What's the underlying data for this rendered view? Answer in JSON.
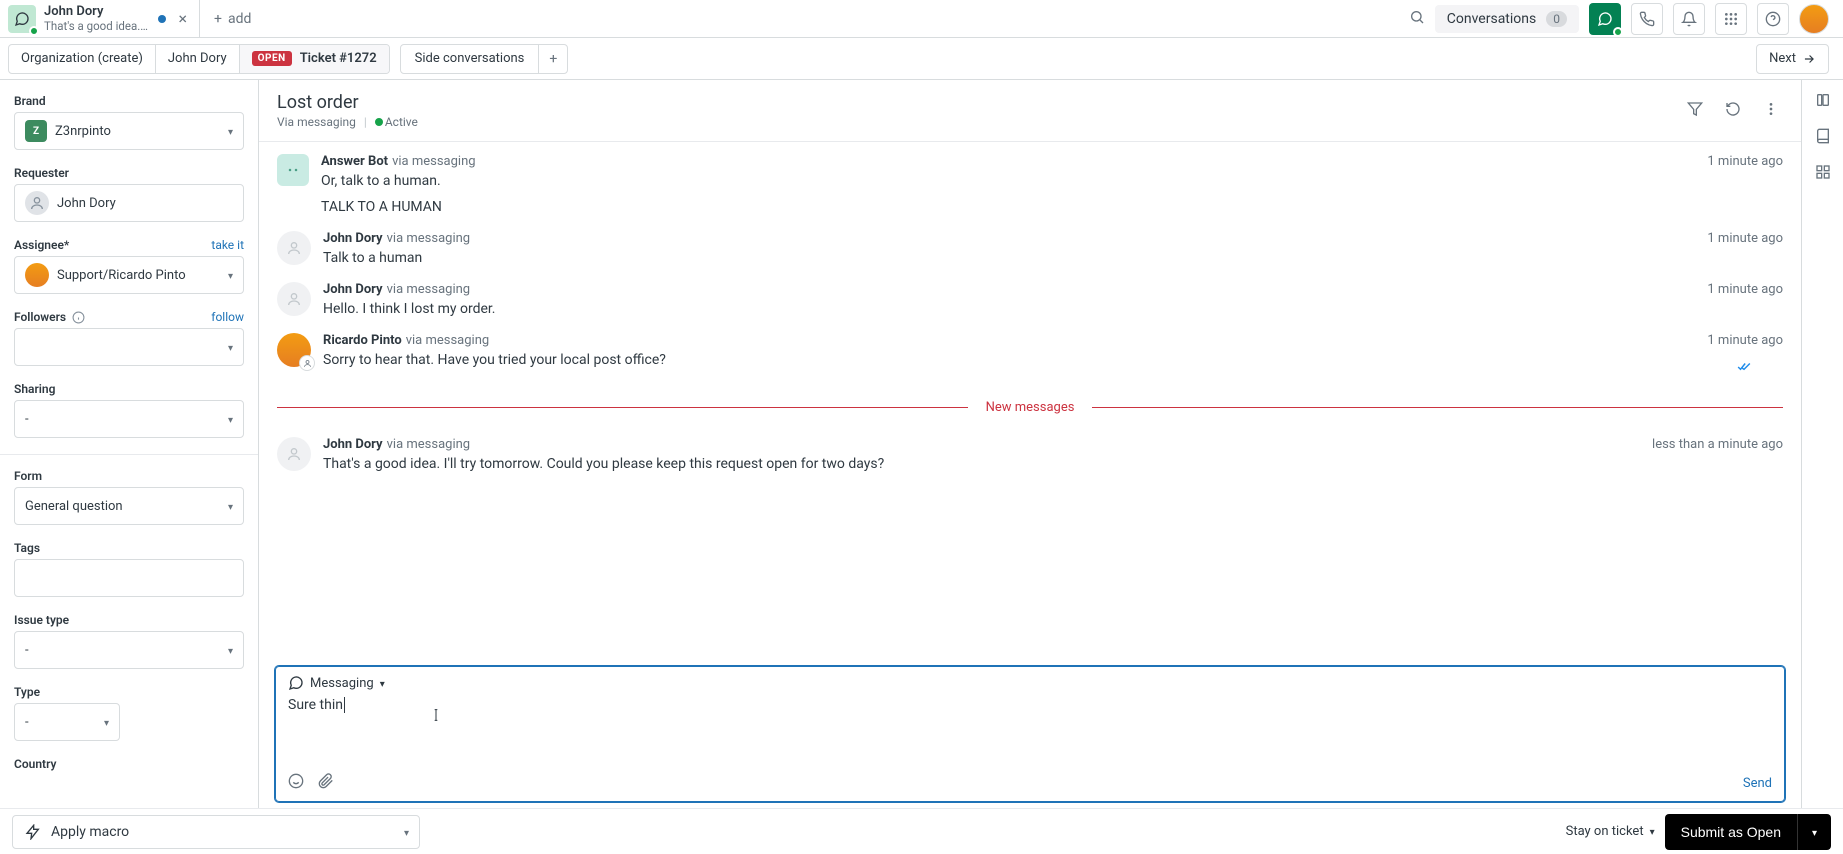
{
  "topTab": {
    "icon": "chat-icon",
    "title": "John Dory",
    "subtitle": "That's a good idea. I...",
    "close": "×"
  },
  "addTab": {
    "plus": "+",
    "label": "add"
  },
  "toolbar": {
    "conversations_label": "Conversations",
    "conversations_count": "0"
  },
  "breadcrumbs": {
    "org": "Organization (create)",
    "requester": "John Dory",
    "ticket_status": "OPEN",
    "ticket_label": "Ticket #1272"
  },
  "sideConversations": {
    "label": "Side conversations",
    "plus": "+"
  },
  "next_label": "Next",
  "sidebar": {
    "brand_label": "Brand",
    "brand_value": "Z3nrpinto",
    "requester_label": "Requester",
    "requester_value": "John Dory",
    "assignee_label": "Assignee*",
    "assignee_takeit": "take it",
    "assignee_value": "Support/Ricardo Pinto",
    "followers_label": "Followers",
    "followers_follow": "follow",
    "sharing_label": "Sharing",
    "sharing_value": "-",
    "form_label": "Form",
    "form_value": "General question",
    "tags_label": "Tags",
    "issuetype_label": "Issue type",
    "issuetype_value": "-",
    "type_label": "Type",
    "type_value": "-",
    "country_label": "Country"
  },
  "conversation": {
    "title": "Lost order",
    "via": "Via messaging",
    "activity": "Active"
  },
  "messages": [
    {
      "avatar": "bot",
      "name": "Answer Bot",
      "via": "via messaging",
      "time": "1 minute ago",
      "lines": [
        "Or, talk to a human.",
        "TALK TO A HUMAN"
      ]
    },
    {
      "avatar": "user",
      "name": "John Dory",
      "via": "via messaging",
      "time": "1 minute ago",
      "lines": [
        "Talk to a human"
      ]
    },
    {
      "avatar": "user",
      "name": "John Dory",
      "via": "via messaging",
      "time": "1 minute ago",
      "lines": [
        "Hello. I think I lost my order."
      ]
    },
    {
      "avatar": "agent",
      "name": "Ricardo Pinto",
      "via": "via messaging",
      "time": "1 minute ago",
      "lines": [
        "Sorry to hear that. Have you tried your local post office?"
      ],
      "read": true
    }
  ],
  "new_divider": "New messages",
  "last_message": {
    "avatar": "user",
    "name": "John Dory",
    "via": "via messaging",
    "time": "less than a minute ago",
    "lines": [
      "That's a good idea. I'll try tomorrow. Could you please keep this request open for two days?"
    ]
  },
  "composer": {
    "channel": "Messaging",
    "text": "Sure thin",
    "send": "Send"
  },
  "bottomBar": {
    "apply_macro": "Apply macro",
    "stay": "Stay on ticket",
    "submit": "Submit as Open"
  },
  "colors": {
    "primary": "#1f73b7",
    "danger": "#cc3340",
    "success": "#038153"
  }
}
